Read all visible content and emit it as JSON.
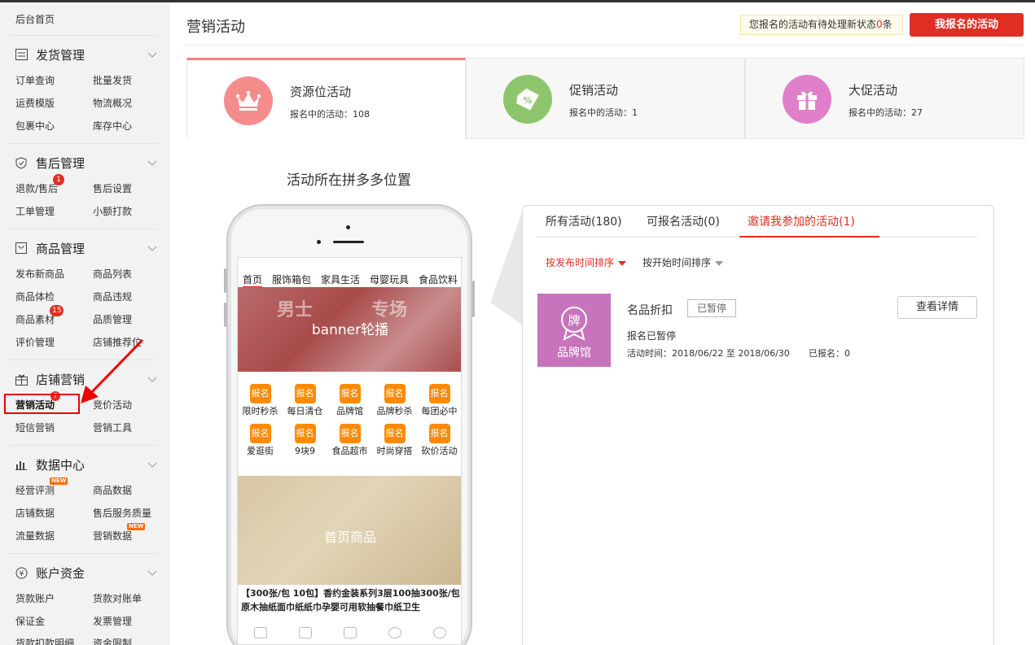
{
  "sidebar": {
    "home": "后台首页",
    "groups": [
      {
        "title": "发货管理",
        "icon": "list-icon",
        "items": [
          "订单查询",
          "批量发货",
          "运费模版",
          "物流概况",
          "包裹中心",
          "库存中心"
        ]
      },
      {
        "title": "售后管理",
        "icon": "shield-icon",
        "items": [
          "退款/售后",
          "售后设置",
          "工单管理",
          "小额打款"
        ],
        "badge": "1"
      },
      {
        "title": "商品管理",
        "icon": "box-icon",
        "items": [
          "发布新商品",
          "商品列表",
          "商品体检",
          "商品违规",
          "商品素材",
          "品质管理",
          "评价管理",
          "店铺推荐位"
        ],
        "badge": "15"
      },
      {
        "title": "店铺营销",
        "icon": "gift-icon",
        "items": [
          "营销活动",
          "竞价活动",
          "短信营销",
          "营销工具"
        ],
        "badge": "7"
      },
      {
        "title": "数据中心",
        "icon": "bar-chart-icon",
        "items": [
          "经营评测",
          "商品数据",
          "店铺数据",
          "售后服务质量",
          "流量数据",
          "营销数据"
        ],
        "new_tag": "NEW"
      },
      {
        "title": "账户资金",
        "icon": "yen-icon",
        "items": [
          "货款账户",
          "货款对账单",
          "保证金",
          "发票管理",
          "货款扣款明细",
          "资金限制"
        ]
      }
    ]
  },
  "header": {
    "title": "营销活动",
    "notice_prefix": "您报名的活动有待处理新状态",
    "notice_count": "0",
    "notice_suffix": "条",
    "my_button": "我报名的活动"
  },
  "cards": [
    {
      "title": "资源位活动",
      "sub": "报名中的活动：108",
      "icon": "crown-icon",
      "color": "#f58c8c"
    },
    {
      "title": "促销活动",
      "sub": "报名中的活动：1",
      "icon": "discount-tag-icon",
      "color": "#8dc56c"
    },
    {
      "title": "大促活动",
      "sub": "报名中的活动：27",
      "icon": "gift-box-icon",
      "color": "#e07fc9"
    }
  ],
  "section_title": "活动所在拼多多位置",
  "phone": {
    "tabs": [
      "首页",
      "服饰箱包",
      "家具生活",
      "母婴玩具",
      "食品饮料"
    ],
    "banner_label": "banner轮播",
    "banner_words": [
      "男士",
      "专场"
    ],
    "grid_button": "报名",
    "grid_items": [
      "限时秒杀",
      "每日清仓",
      "品牌馆",
      "品牌秒杀",
      "每团必中",
      "爱逛街",
      "9块9",
      "食品超市",
      "时尚穿搭",
      "砍价活动"
    ],
    "goods_label": "首页商品",
    "goods_title": "【300张/包 10包】香约金装系列3层100抽300张/包原木抽纸面巾纸纸巾孕婴可用软抽餐巾纸卫生"
  },
  "panel": {
    "tabs": [
      "所有活动(180)",
      "可报名活动(0)",
      "邀请我参加的活动(1)"
    ],
    "sorts": [
      "按发布时间排序",
      "按开始时间排序"
    ],
    "activity": {
      "thumb_char": "牌",
      "thumb_label": "品牌馆",
      "name": "名品折扣",
      "tag": "已暂停",
      "status": "报名已暂停",
      "time": "活动时间：2018/06/22 至 2018/06/30",
      "count": "已报名：0",
      "detail_button": "查看详情"
    }
  }
}
